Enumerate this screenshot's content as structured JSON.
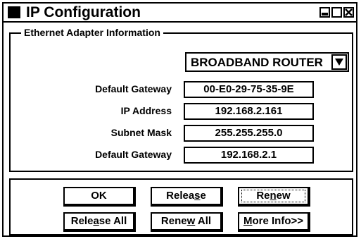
{
  "window": {
    "title": "IP Configuration",
    "controls": [
      "minimize-icon",
      "maximize-icon",
      "close-icon"
    ]
  },
  "adapter_group": {
    "label": "Ethernet Adapter Information",
    "adapter_select": {
      "selected": "BROADBAND ROUTER",
      "icon": "chevron-down-icon"
    },
    "fields": [
      {
        "label": "Default Gateway",
        "value": "00-E0-29-75-35-9E"
      },
      {
        "label": "IP Address",
        "value": "192.168.2.161"
      },
      {
        "label": "Subnet Mask",
        "value": "255.255.255.0"
      },
      {
        "label": "Default Gateway",
        "value": "192.168.2.1"
      }
    ]
  },
  "buttons": {
    "ok": {
      "label": "OK"
    },
    "release": {
      "pre": "Relea",
      "mnemonic": "s",
      "post": "e"
    },
    "renew": {
      "pre": "Re",
      "mnemonic": "n",
      "post": "ew"
    },
    "release_all": {
      "pre": "Rele",
      "mnemonic": "a",
      "post": "se All"
    },
    "renew_all": {
      "pre": "Rene",
      "mnemonic": "w",
      "post": " All"
    },
    "more_info": {
      "pre": "",
      "mnemonic": "M",
      "post": "ore Info>>"
    }
  }
}
